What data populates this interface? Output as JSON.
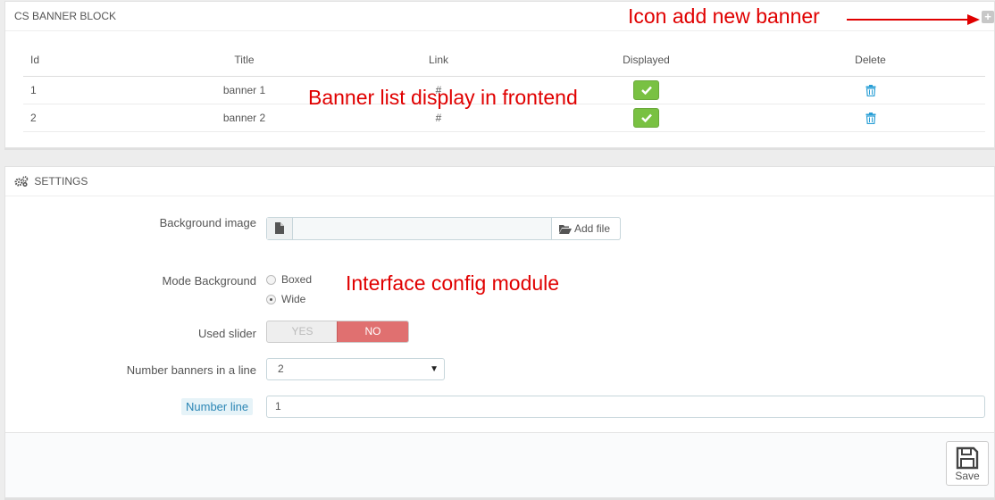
{
  "banner_block": {
    "title": "CS BANNER BLOCK",
    "add_icon": "plus-icon",
    "columns": [
      "Id",
      "Title",
      "Link",
      "Displayed",
      "Delete"
    ],
    "rows": [
      {
        "id": "1",
        "title": "banner 1",
        "link": "#",
        "displayed": true
      },
      {
        "id": "2",
        "title": "banner 2",
        "link": "#",
        "displayed": true
      }
    ]
  },
  "annotations": {
    "add_banner": "Icon add new banner",
    "banner_list": "Banner list display in frontend",
    "config": "Interface config module",
    "color": "#e00000"
  },
  "settings": {
    "title": "SETTINGS",
    "background_image": {
      "label": "Background image",
      "button": "Add file",
      "value": ""
    },
    "mode_background": {
      "label": "Mode Background",
      "options": [
        "Boxed",
        "Wide"
      ],
      "selected": "Wide"
    },
    "used_slider": {
      "label": "Used slider",
      "yes": "YES",
      "no": "NO",
      "value": "NO"
    },
    "number_banners": {
      "label": "Number banners in a line",
      "value": "2"
    },
    "number_line": {
      "label": "Number line",
      "value": "1"
    },
    "save_label": "Save"
  },
  "colors": {
    "success": "#79c142",
    "danger": "#e07070",
    "link": "#2b86b5"
  }
}
